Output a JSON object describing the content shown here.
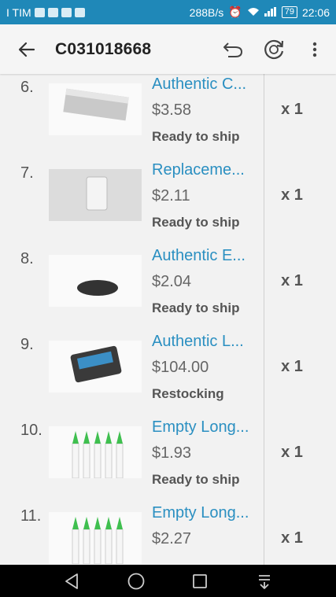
{
  "statusbar": {
    "carrier": "I TIM",
    "speed": "288B/s",
    "battery": "79",
    "time": "22:06"
  },
  "appbar": {
    "title": "C031018668"
  },
  "items": [
    {
      "num": "6.",
      "name": "Authentic C...",
      "price": "$3.58",
      "status": "Ready to ship",
      "qty": "x 1"
    },
    {
      "num": "7.",
      "name": "Replaceme...",
      "price": "$2.11",
      "status": "Ready to ship",
      "qty": "x 1"
    },
    {
      "num": "8.",
      "name": "Authentic E...",
      "price": "$2.04",
      "status": "Ready to ship",
      "qty": "x 1"
    },
    {
      "num": "9.",
      "name": "Authentic L...",
      "price": "$104.00",
      "status": "Restocking",
      "qty": "x 1"
    },
    {
      "num": "10.",
      "name": "Empty Long...",
      "price": "$1.93",
      "status": "Ready to ship",
      "qty": "x 1"
    },
    {
      "num": "11.",
      "name": "Empty Long...",
      "price": "$2.27",
      "status": "",
      "qty": "x 1"
    }
  ]
}
